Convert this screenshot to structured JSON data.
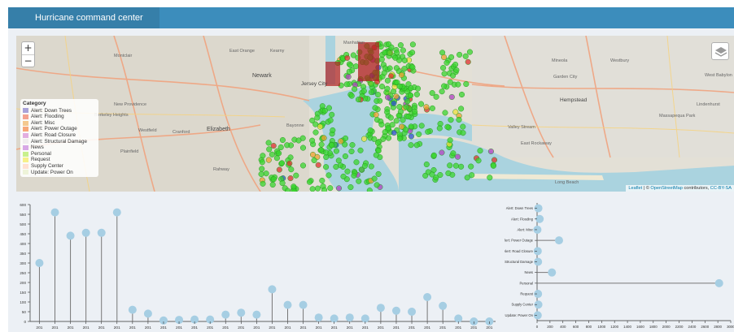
{
  "header": {
    "title": "Hurricane command center"
  },
  "map": {
    "zoom_in": "+",
    "zoom_out": "−",
    "layers_icon": "layers-icon",
    "legend_title": "Category",
    "legend": [
      {
        "label": "Alert: Down Trees",
        "color": "#a9a3d9"
      },
      {
        "label": "Alert: Flooding",
        "color": "#f3a28f"
      },
      {
        "label": "Alert: Misc",
        "color": "#f4c98f"
      },
      {
        "label": "Alert: Power Outage",
        "color": "#f7a87a"
      },
      {
        "label": "Alert: Road Closure",
        "color": "#e2aee0"
      },
      {
        "label": "Alert: Structural Damage",
        "color": "#f0eeee"
      },
      {
        "label": "News",
        "color": "#d7a8e6"
      },
      {
        "label": "Personal",
        "color": "#c8f08c"
      },
      {
        "label": "Request",
        "color": "#f6f08a"
      },
      {
        "label": "Supply Center",
        "color": "#ffe1d2"
      },
      {
        "label": "Update: Power On",
        "color": "#eef3d9"
      }
    ],
    "place_labels": [
      "Montclair",
      "East Orange",
      "Kearny",
      "Newark",
      "Jersey City",
      "Manhattan",
      "Elizabeth",
      "Bayonne",
      "New Providence",
      "Berkeley Heights",
      "Westfield",
      "Cranford",
      "Plainfield",
      "Rahway",
      "Hempstead",
      "Garden City",
      "Long Beach",
      "Valley Stream",
      "Massapequa Park",
      "Lindenhurst",
      "West Babylon",
      "East Rockaway",
      "Westbury",
      "Mineola"
    ],
    "attribution": {
      "leaflet": "Leaflet",
      "sep": " | © ",
      "osm": "OpenStreetMap",
      "rest": " contributors, ",
      "license": "CC-BY-SA"
    }
  },
  "chart_data": [
    {
      "type": "lollipop",
      "title": "",
      "ylim": [
        0,
        600
      ],
      "yticks": [
        0,
        50,
        100,
        150,
        200,
        250,
        300,
        350,
        400,
        450,
        500,
        550,
        600
      ],
      "categories": [
        "201",
        "201",
        "201",
        "201",
        "201",
        "201",
        "201",
        "201",
        "201",
        "201",
        "201",
        "201",
        "201",
        "201",
        "201",
        "201",
        "201",
        "201",
        "201",
        "201",
        "201",
        "201",
        "201",
        "201",
        "201",
        "201",
        "201",
        "201",
        "201",
        "201"
      ],
      "values": [
        300,
        560,
        440,
        455,
        455,
        560,
        60,
        40,
        5,
        8,
        10,
        10,
        35,
        45,
        35,
        165,
        85,
        85,
        20,
        15,
        20,
        15,
        70,
        55,
        50,
        125,
        80,
        15,
        0,
        0
      ]
    },
    {
      "type": "lollipop-horizontal",
      "title": "",
      "xlim": [
        0,
        3000
      ],
      "xticks": [
        0,
        200,
        400,
        600,
        800,
        1000,
        1200,
        1400,
        1600,
        1800,
        2000,
        2200,
        2400,
        2600,
        2800,
        3000
      ],
      "categories": [
        "Alert: Down Trees",
        "Alert: Flooding",
        "Alert: Misc",
        "Alert: Power Outage",
        "Alert: Road Closure",
        "Alert: Structural Damage",
        "News",
        "Personal",
        "Request",
        "Supply Center",
        "Update: Power On"
      ],
      "values": [
        20,
        40,
        5,
        340,
        10,
        15,
        230,
        2820,
        15,
        20,
        10
      ]
    }
  ]
}
